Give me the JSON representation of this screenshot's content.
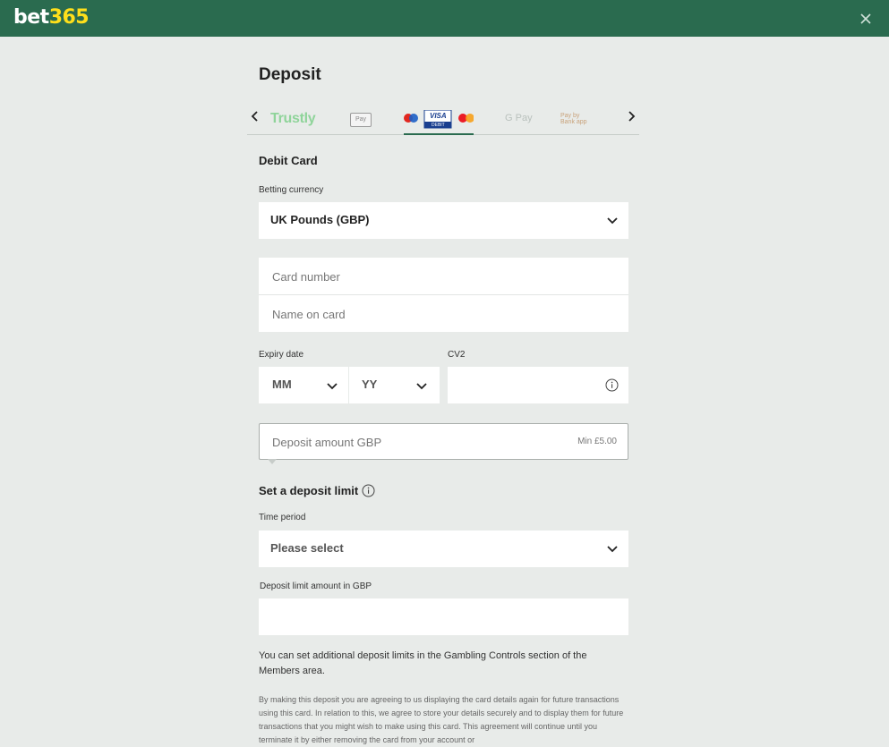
{
  "brand": {
    "logo_white": "bet",
    "logo_yellow": "365",
    "accent": "#2a6b4f",
    "logo_yellow_color": "#ffdf1b"
  },
  "header": {
    "close_icon": "close-icon"
  },
  "page": {
    "title": "Deposit"
  },
  "methods": {
    "items": [
      "Trustly",
      "Pay",
      "VISA",
      "DEBIT",
      "G Pay",
      "Pay by Bank app"
    ],
    "selected": "Debit Card"
  },
  "form": {
    "section_title": "Debit Card",
    "currency_label": "Betting currency",
    "currency_value": "UK Pounds (GBP)",
    "card_number_placeholder": "Card number",
    "name_on_card_placeholder": "Name on card",
    "expiry_label": "Expiry date",
    "cv2_label": "CV2",
    "month_value": "MM",
    "year_value": "YY",
    "amount_placeholder": "Deposit amount GBP",
    "amount_min": "Min £5.00"
  },
  "limit": {
    "title": "Set a deposit limit",
    "period_label": "Time period",
    "period_value": "Please select",
    "amount_label": "Deposit limit amount in GBP",
    "amount_value": ""
  },
  "info_text": "You can set additional deposit limits in the Gambling Controls section of the Members area.",
  "fine_print": "By making this deposit you are agreeing to us displaying the card details again for future transactions using this card. In relation to this, we agree to store your details securely and to display them for future transactions that you might wish to make using this card. This agreement will continue until you terminate it by either removing the card from your account or"
}
